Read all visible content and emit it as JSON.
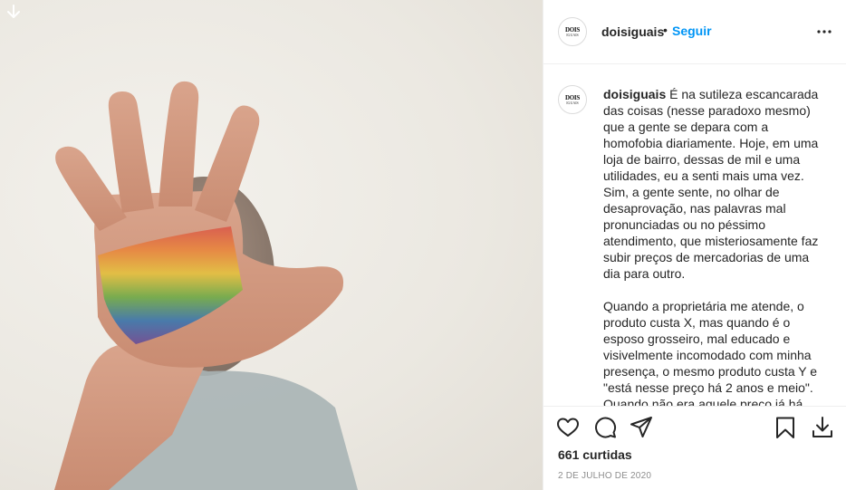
{
  "post": {
    "username": "doisiguais",
    "dot": "•",
    "follow_label": "Seguir",
    "avatar_text_top": "DOIS",
    "avatar_text_bottom": "IGUAIS",
    "caption_username": "doisiguais",
    "caption_text": " É na sutileza escancarada das coisas (nesse paradoxo mesmo) que a gente se depara com a homofobia diariamente. Hoje, em uma loja de bairro, dessas de mil e uma utilidades, eu a senti mais uma vez. Sim, a gente sente, no olhar de desaprovação, nas palavras mal pronunciadas ou no péssimo atendimento, que misteriosamente faz subir preços de mercadorias de uma dia para outro.\n\nQuando a proprietária me atende, o produto custa X, mas quando é o esposo grosseiro, mal educado e visivelmente incomodado com minha presença, o mesmo produto custa Y e \"está nesse preço há 2 anos e meio\". Quando não era aquele preço já há",
    "likes": "661 curtidas",
    "date": "2 de julho de 2020"
  },
  "icons": {
    "download_corner": "download-arrow-icon",
    "more": "more-options-icon",
    "like": "heart-icon",
    "comment": "comment-icon",
    "share": "paper-plane-icon",
    "save": "bookmark-icon",
    "download": "download-icon"
  },
  "colors": {
    "accent": "#0095f6",
    "text": "#262626",
    "muted": "#8e8e8e",
    "border": "#efefef"
  }
}
